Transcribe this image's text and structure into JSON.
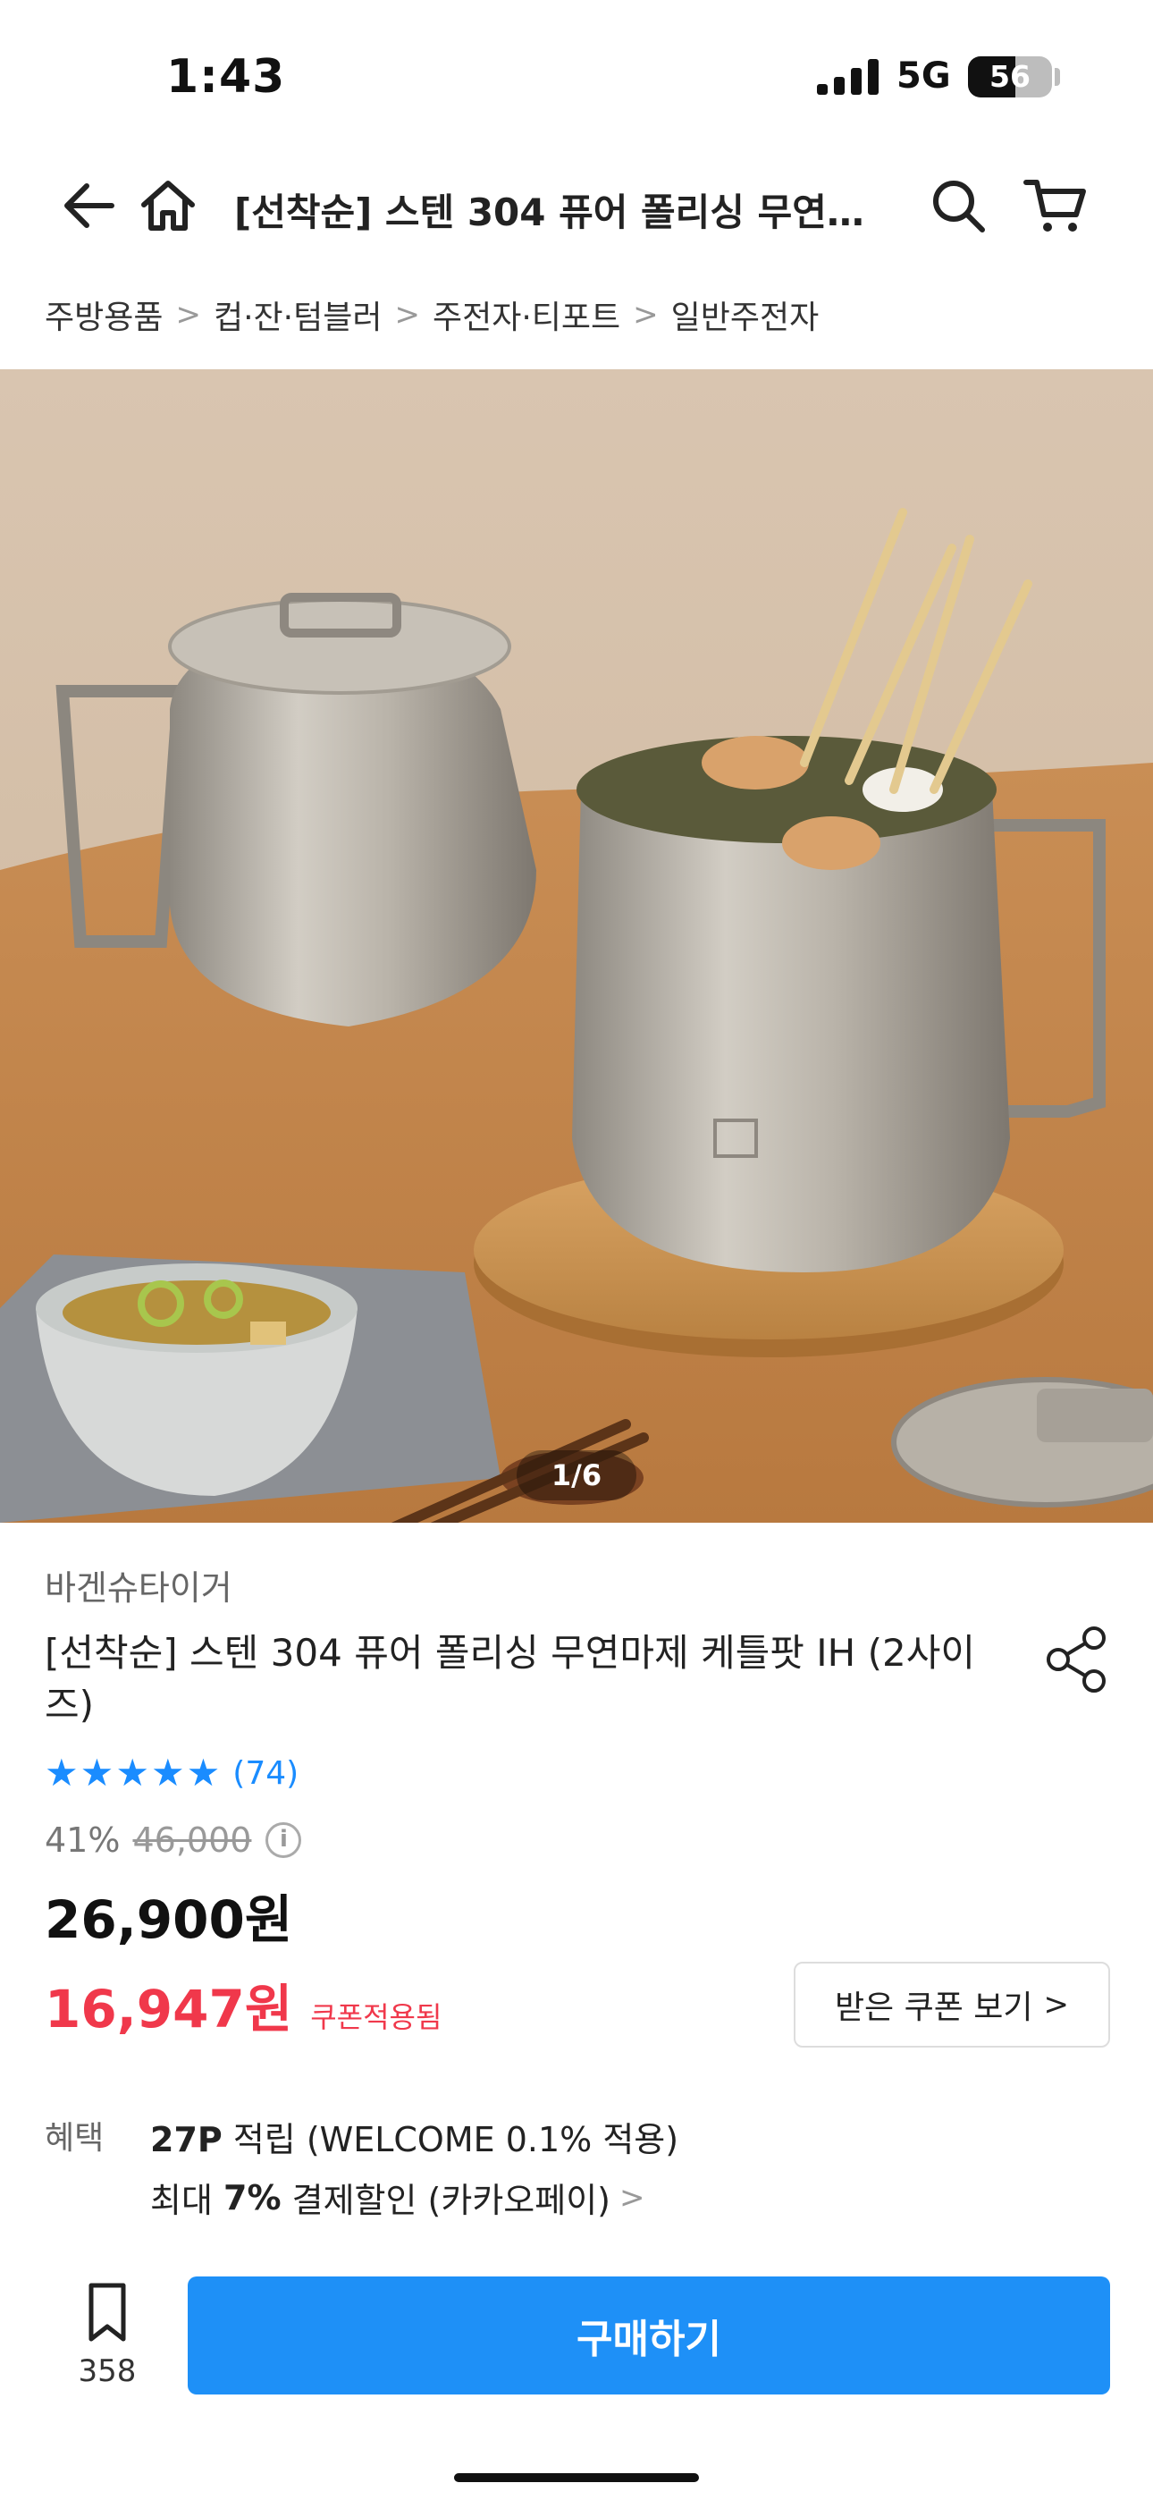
{
  "status_bar": {
    "time": "1:43",
    "network": "5G",
    "battery": "56",
    "battery_level": 0.56
  },
  "nav": {
    "title": "[선착순] 스텐 304 퓨어 폴리싱 무연마..."
  },
  "breadcrumb": [
    "주방용품",
    "컵·잔·텀블러",
    "주전자·티포트",
    "일반주전자"
  ],
  "gallery": {
    "pager": "1/6"
  },
  "product": {
    "seller": "바겐슈타이거",
    "title": "[선착순] 스텐 304 퓨어 폴리싱 무연마제 케틀팟 IH (2사이즈)",
    "rating": {
      "stars": 5,
      "count": "(74)"
    },
    "discount_rate": "41%",
    "original_price": "46,000",
    "price": "26,900원",
    "coupon_price": "16,947원",
    "coupon_tag": "쿠폰적용됨",
    "coupon_button": "받은 쿠폰 보기"
  },
  "benefits": {
    "label": "혜택",
    "points_bold": "27P",
    "points_text": " 적립 (WELCOME 0.1% 적용)",
    "pay_prefix": "최대 ",
    "pay_bold": "7%",
    "pay_text": " 결제할인 (카카오페이)"
  },
  "bottom_bar": {
    "bookmark_count": "358",
    "buy_label": "구매하기"
  },
  "colors": {
    "accent": "#1e90f7",
    "rating": "#1a8cff",
    "sale": "#f0384b"
  }
}
